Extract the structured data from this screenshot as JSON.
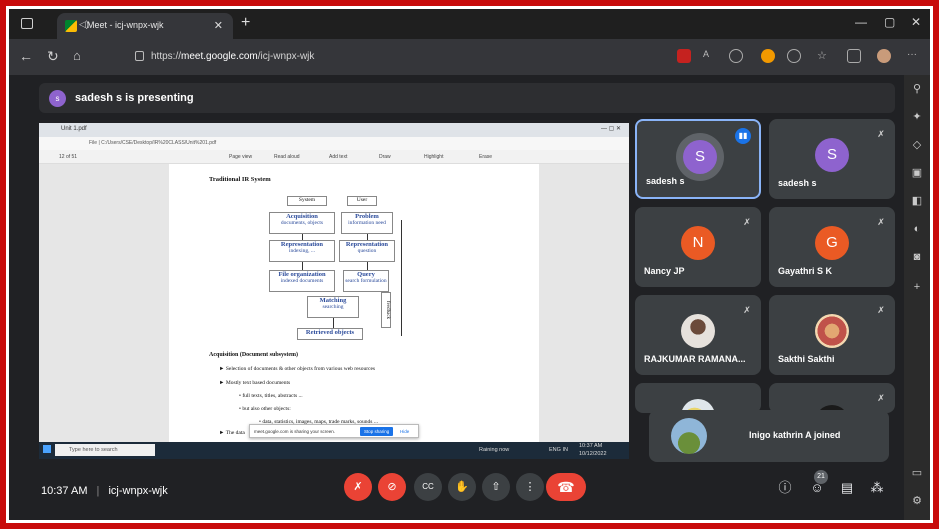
{
  "browser": {
    "tab_title": "Meet - icj-wnpx-wjk",
    "address_prefix": "https://",
    "address_host": "meet.google.com",
    "address_path": "/icj-wnpx-wjk"
  },
  "meet": {
    "presenting_text": "sadesh s is presenting",
    "presenter_initial": "s",
    "meeting_time": "10:37 AM",
    "separator": "|",
    "meeting_code": "icj-wnpx-wjk",
    "participant_count": "21",
    "join_toast": "Inigo kathrin A joined",
    "colors": {
      "accent": "#1a73e8",
      "danger": "#ea4335",
      "tile_bg": "#3c4043",
      "page_bg": "#202124"
    }
  },
  "participants": [
    {
      "name": "sadesh s",
      "initial": "S",
      "color": "#8e63ce",
      "speaking": true
    },
    {
      "name": "sadesh s",
      "initial": "S",
      "color": "#8e63ce",
      "muted": true
    },
    {
      "name": "Nancy JP",
      "initial": "N",
      "color": "#ea5a24",
      "muted": true
    },
    {
      "name": "Gayathri S K",
      "initial": "G",
      "color": "#ea5a24",
      "muted": true
    },
    {
      "name": "RAJKUMAR RAMANA...",
      "photo": true,
      "muted": true
    },
    {
      "name": "Sakthi Sakthi",
      "photo": true,
      "muted": true
    }
  ],
  "shared_screen": {
    "tab": "Unit 1.pdf",
    "file_path": "File | C:/Users/CSE/Desktop/IR%20CLASS/Unit%201.pdf",
    "page_indicator": "12 of 51",
    "pdf_tools": [
      "Page view",
      "Read aloud",
      "Add text",
      "Draw",
      "Highlight",
      "Erase"
    ],
    "heading": "Traditional IR System",
    "diagram": {
      "left_label": "System",
      "right_label": "User",
      "boxes": [
        {
          "title": "Acquisition",
          "sub": "documents, objects"
        },
        {
          "title": "Problem",
          "sub": "information need"
        },
        {
          "title": "Representation",
          "sub": "indexing, ..."
        },
        {
          "title": "Representation",
          "sub": "question"
        },
        {
          "title": "File organization",
          "sub": "indexed documents"
        },
        {
          "title": "Query",
          "sub": "search formulation"
        },
        {
          "title": "Matching",
          "sub": "searching"
        },
        {
          "title": "Retrieved objects",
          "sub": ""
        }
      ],
      "feedback": "feedback"
    },
    "subheading": "Acquisition (Document subsystem)",
    "bullets": [
      "Selection of documents & other objects from various web resources",
      "Mostly text based documents",
      "full texts, titles, abstracts ...",
      "but also other objects:",
      "data, statistics, images, maps, trade marks, sounds ...",
      "The data"
    ],
    "share_toast": "meet.google.com is sharing your screen.",
    "stop_sharing": "Stop sharing",
    "hide": "Hide",
    "taskbar_search": "Type here to search",
    "taskbar_status": "Raining now",
    "taskbar_lang": "ENG IN",
    "taskbar_time": "10:37 AM",
    "taskbar_date": "10/12/2022"
  }
}
